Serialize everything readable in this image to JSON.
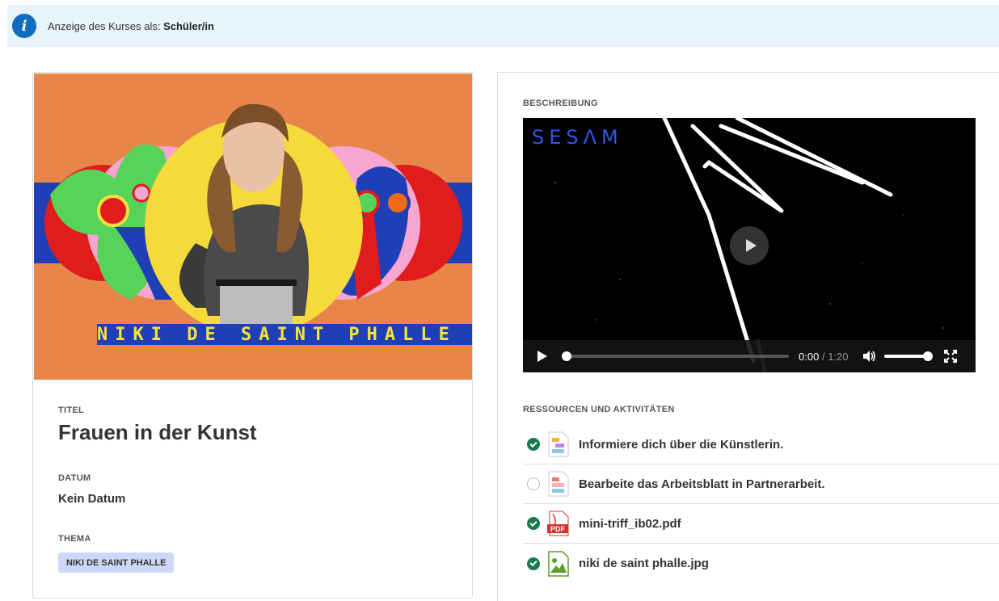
{
  "banner": {
    "icon": "info-icon",
    "prefix": "Anzeige des Kurses als:",
    "role": "Schüler/in"
  },
  "course": {
    "hero_caption": "NIKI DE SAINT PHALLE",
    "title_label": "TITEL",
    "title": "Frauen in der Kunst",
    "date_label": "DATUM",
    "date": "Kein Datum",
    "topic_label": "THEMA",
    "topic_tag": "NIKI DE SAINT PHALLE"
  },
  "description": {
    "label": "BESCHREIBUNG",
    "video": {
      "logo": "SESΛM",
      "current_time": "0:00",
      "separator": "/",
      "duration": "1:20"
    }
  },
  "resources": {
    "label": "RESSOURCEN UND AKTIVITÄTEN",
    "items": [
      {
        "name": "Informiere dich über die Künstlerin.",
        "completed": true,
        "icon": "page-icon"
      },
      {
        "name": "Bearbeite das Arbeitsblatt in Partnerarbeit.",
        "completed": false,
        "icon": "assignment-icon"
      },
      {
        "name": "mini-triff_ib02.pdf",
        "completed": true,
        "icon": "pdf-icon"
      },
      {
        "name": "niki de saint phalle.jpg",
        "completed": true,
        "icon": "image-icon"
      }
    ]
  },
  "colors": {
    "accent": "#0f6cbf",
    "completed": "#1a7a4e",
    "banner_bg": "#e8f4fb",
    "tag_bg": "#cdd8f6"
  }
}
